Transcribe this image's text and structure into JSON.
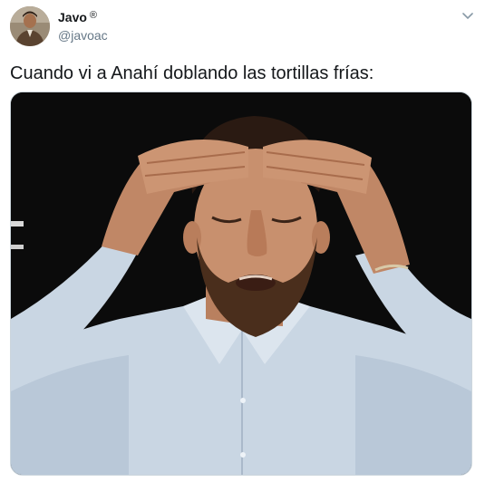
{
  "author": {
    "display_name": "Javo",
    "registered_mark": "®",
    "handle": "@javoac",
    "avatar_icon": "profile-photo"
  },
  "menu": {
    "icon": "chevron-down-icon"
  },
  "tweet": {
    "text": "Cuando vi a Anahí doblando las tortillas frías:"
  },
  "media": {
    "icon": "photo",
    "colors": {
      "background": "#0b0b0b",
      "shirt": "#c9d6e3",
      "skin": "#c8906e",
      "beard": "#4a2e1c"
    }
  }
}
